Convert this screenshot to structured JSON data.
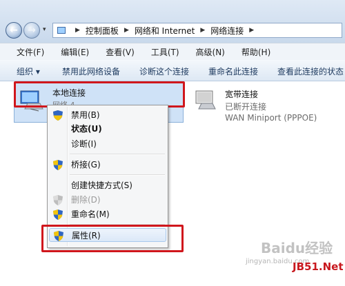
{
  "address": {
    "crumbs": [
      "控制面板",
      "网络和 Internet",
      "网络连接"
    ]
  },
  "menu": [
    "文件(F)",
    "编辑(E)",
    "查看(V)",
    "工具(T)",
    "高级(N)",
    "帮助(H)"
  ],
  "commands": [
    "组织 ▾",
    "禁用此网络设备",
    "诊断这个连接",
    "重命名此连接",
    "查看此连接的状态"
  ],
  "connections": {
    "local": {
      "name": "本地连接",
      "sub": "网络 4"
    },
    "broadband": {
      "name": "宽带连接",
      "status": "已断开连接",
      "device": "WAN Miniport (PPPOE)"
    }
  },
  "context_menu": {
    "disable": "禁用(B)",
    "status": "状态(U)",
    "diagnose": "诊断(I)",
    "bridge": "桥接(G)",
    "shortcut": "创建快捷方式(S)",
    "delete": "删除(D)",
    "rename": "重命名(M)",
    "properties": "属性(R)"
  },
  "colors": {
    "highlight": "#d0161c",
    "accent": "#3c6aa8"
  },
  "icons": [
    "back-arrow-icon",
    "forward-arrow-icon",
    "computer-icon",
    "network-adapter-icon",
    "uac-shield-icon"
  ],
  "watermark": {
    "brand": "Baidu经验",
    "site": "jingyan.baidu.com",
    "logo": "JB51.Net"
  }
}
